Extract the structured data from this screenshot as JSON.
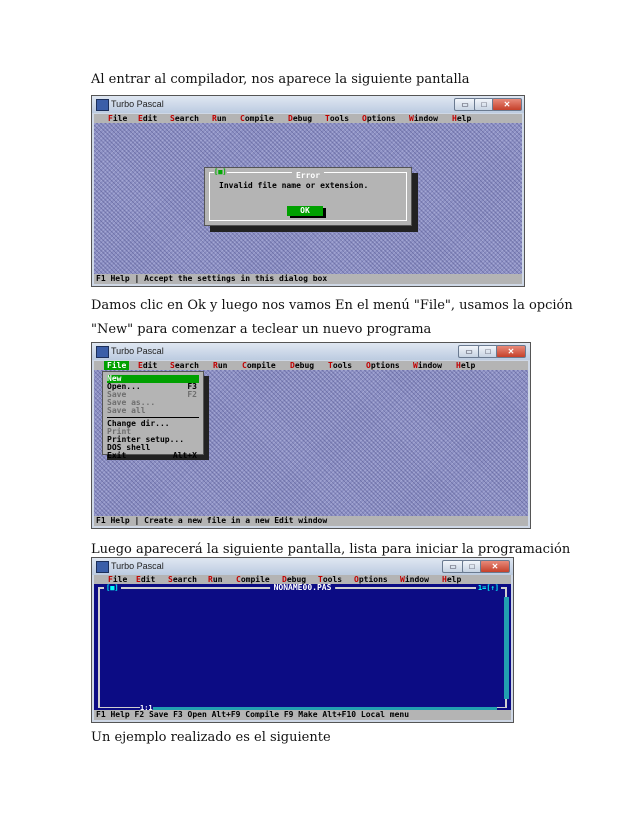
{
  "paragraphs": {
    "p1": "Al entrar al compilador, nos aparece la siguiente pantalla",
    "p2": "Damos clic en Ok y luego nos vamos En el menú \"File\", usamos la opción",
    "p3": "\"New\" para comenzar a teclear un nuevo programa",
    "p4": "Luego aparecerá la siguiente pantalla, lista para iniciar la programación",
    "p5": "Un ejemplo realizado es el siguiente"
  },
  "window": {
    "title": "Turbo Pascal",
    "min": "▭",
    "max": "□",
    "close": "✕"
  },
  "menu": {
    "items": [
      "File",
      "Edit",
      "Search",
      "Run",
      "Compile",
      "Debug",
      "Tools",
      "Options",
      "Window",
      "Help"
    ],
    "hot": [
      "F",
      "E",
      "S",
      "R",
      "C",
      "D",
      "T",
      "O",
      "W",
      "H"
    ]
  },
  "shot1": {
    "dialog_title": "Error",
    "dialog_icon": "[■]",
    "message": "Invalid file name or extension.",
    "ok_label": "OK",
    "status": "F1 Help | Accept the settings in this dialog box"
  },
  "shot2": {
    "dropdown": [
      {
        "label": "New",
        "key": ""
      },
      {
        "label": "Open...",
        "key": "F3"
      },
      {
        "label": "Save",
        "key": "F2"
      },
      {
        "label": "Save as...",
        "key": ""
      },
      {
        "label": "Save all",
        "key": ""
      },
      {
        "label": "Change dir...",
        "key": ""
      },
      {
        "label": "Print",
        "key": ""
      },
      {
        "label": "Printer setup...",
        "key": ""
      },
      {
        "label": "DOS shell",
        "key": ""
      },
      {
        "label": "Exit",
        "key": "Alt+X"
      }
    ],
    "status": "F1 Help | Create a new file in a new Edit window"
  },
  "shot3": {
    "editor_title": "NONAME00.PAS",
    "left_corner": "[■]",
    "right_corner": "1=[↑]",
    "cursor_pos": "1:1",
    "status": "F1 Help  F2 Save  F3 Open  Alt+F9 Compile  F9 Make  Alt+F10 Local menu"
  }
}
